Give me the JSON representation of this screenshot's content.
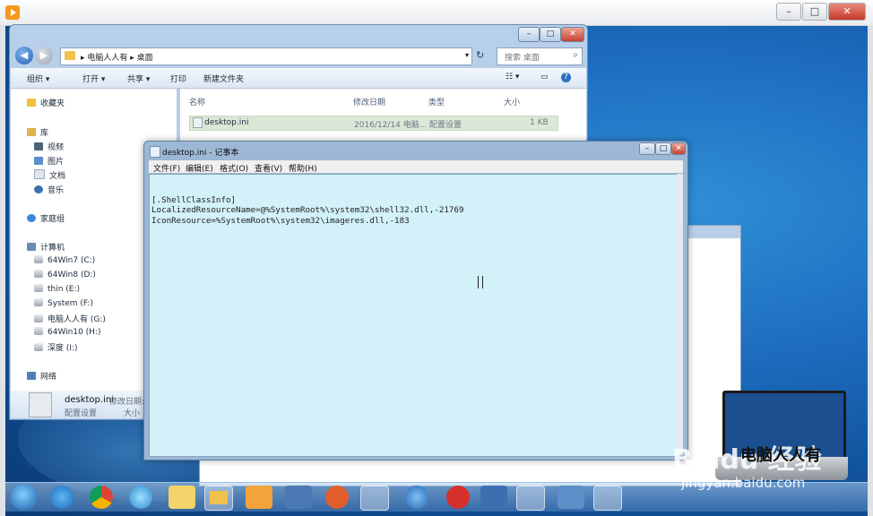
{
  "explorer": {
    "breadcrumb": [
      "电脑人人有",
      "桌面"
    ],
    "search_placeholder": "搜索 桌面",
    "toolbar": [
      "组织 ▾",
      "打开 ▾",
      "共享 ▾",
      "打印",
      "新建文件夹"
    ],
    "nav": {
      "favorites": "收藏夹",
      "libraries": "库",
      "library_items": [
        "视频",
        "图片",
        "文档",
        "音乐"
      ],
      "homegroup": "家庭组",
      "computer": "计算机",
      "drives": [
        "64Win7 (C:)",
        "64Win8 (D:)",
        "thin (E:)",
        "System (F:)",
        "电脑人人有 (G:)",
        "64Win10 (H:)",
        "深度 (I:)"
      ],
      "network": "网络"
    },
    "columns": [
      "名称",
      "修改日期",
      "类型",
      "大小"
    ],
    "files": [
      {
        "name": "desktop.ini",
        "date": "2016/12/14 电脑...",
        "type": "配置设置",
        "size": "1 KB"
      }
    ],
    "details": {
      "name": "desktop.ini",
      "date_label": "修改日期:",
      "type": "配置设置",
      "size_label": "大小"
    }
  },
  "notepad": {
    "title": "desktop.ini - 记事本",
    "menu": [
      "文件(F)",
      "编辑(E)",
      "格式(O)",
      "查看(V)",
      "帮助(H)"
    ],
    "content": "\n[.ShellClassInfo]\nLocalizedResourceName=@%SystemRoot%\\system32\\shell32.dll,-21769\nIconResource=%SystemRoot%\\system32\\imageres.dll,-183"
  },
  "watermark": {
    "brand": "Baidu 经验",
    "url": "jingyan.baidu.com",
    "overlay_text": "电脑人人有"
  }
}
